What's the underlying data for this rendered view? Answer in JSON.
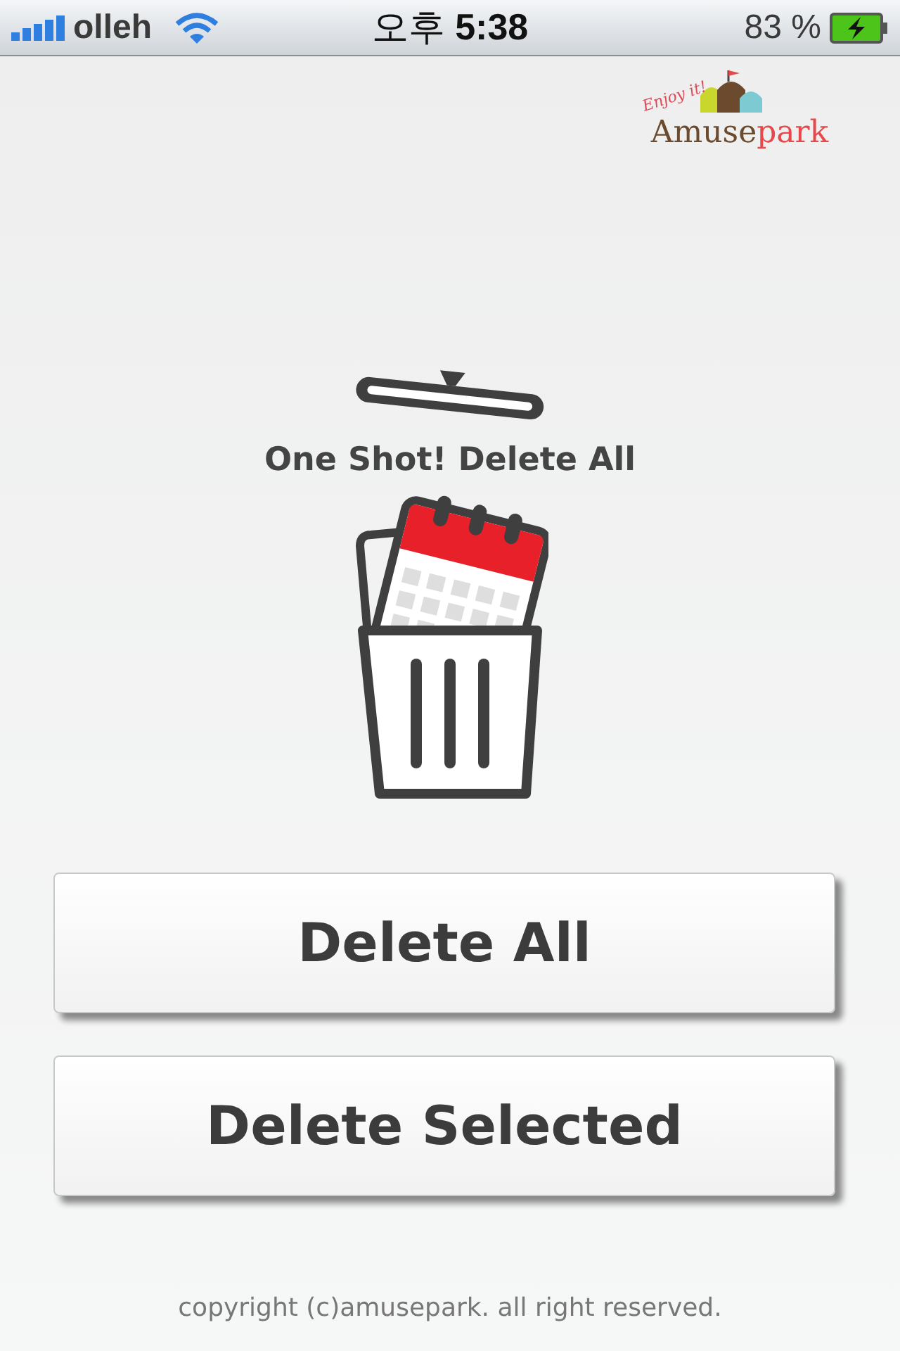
{
  "status_bar": {
    "carrier": "olleh",
    "time_prefix": "오후",
    "time": "5:38",
    "battery": "83 %"
  },
  "logo": {
    "tagline": "Enjoy it!",
    "name_first": "Amuse",
    "name_second": "park"
  },
  "headline": "One Shot! Delete All",
  "buttons": [
    {
      "label": "Delete All"
    },
    {
      "label": "Delete Selected"
    }
  ],
  "footer": "copyright (c)amusepark. all right reserved."
}
